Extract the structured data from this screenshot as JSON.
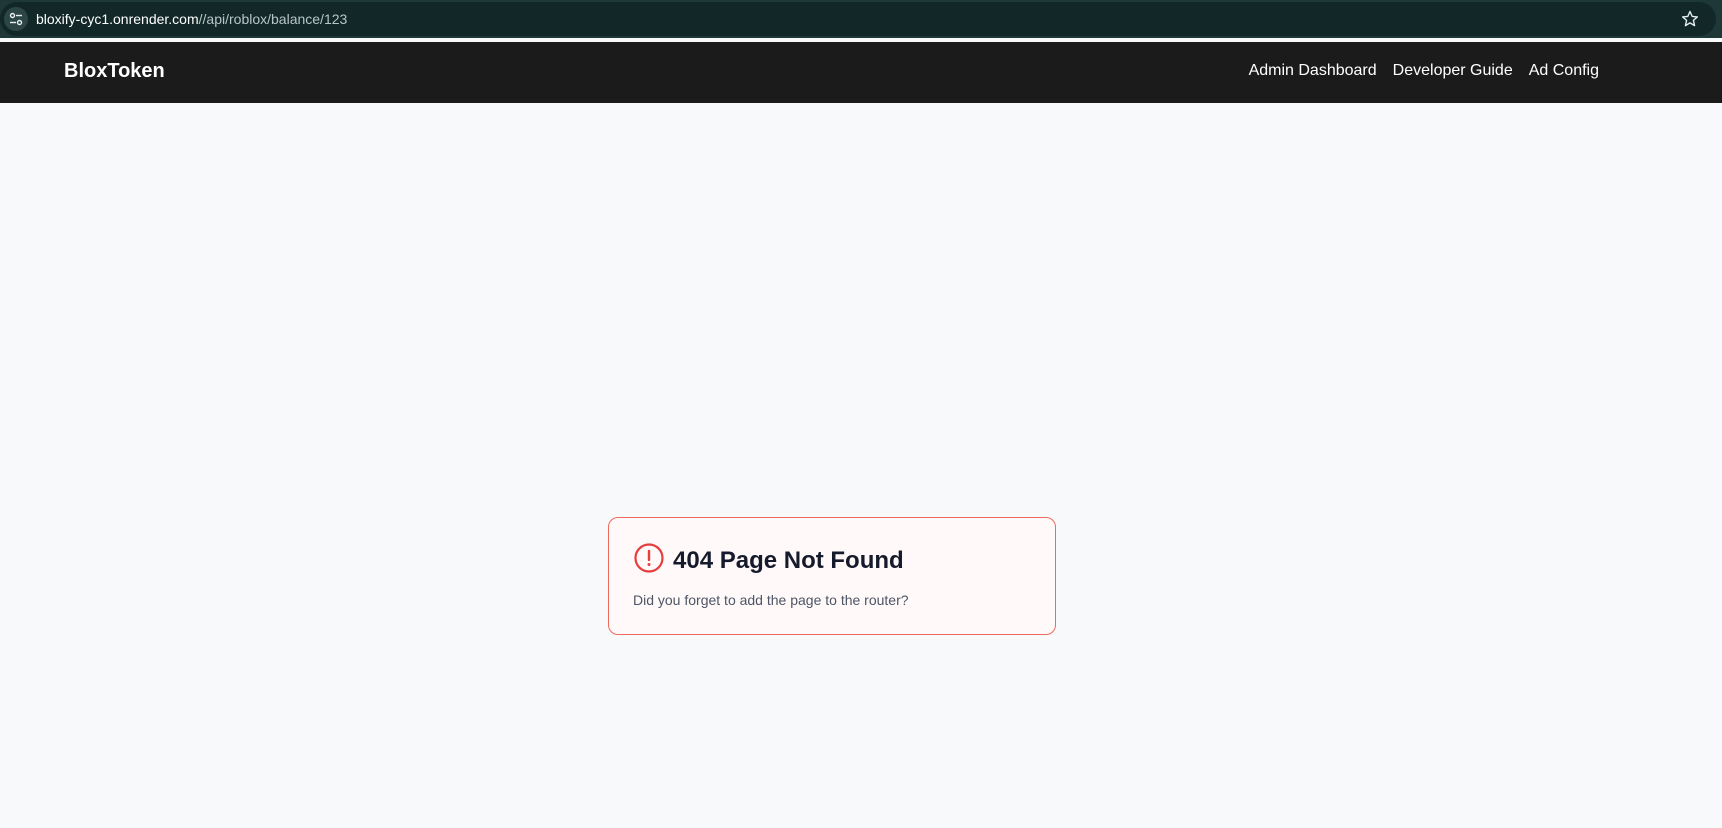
{
  "browser": {
    "url_host": "bloxify-cyc1.onrender.com",
    "url_path": "//api/roblox/balance/123",
    "site_info_icon": "tune-icon",
    "bookmark_icon": "star-icon"
  },
  "header": {
    "logo": "BloxToken",
    "nav": [
      {
        "label": "Admin Dashboard"
      },
      {
        "label": "Developer Guide"
      },
      {
        "label": "Ad Config"
      }
    ]
  },
  "error": {
    "icon": "alert-circle-icon",
    "title": "404 Page Not Found",
    "message": "Did you forget to add the page to the router?",
    "accent_color": "#e53e3e"
  }
}
